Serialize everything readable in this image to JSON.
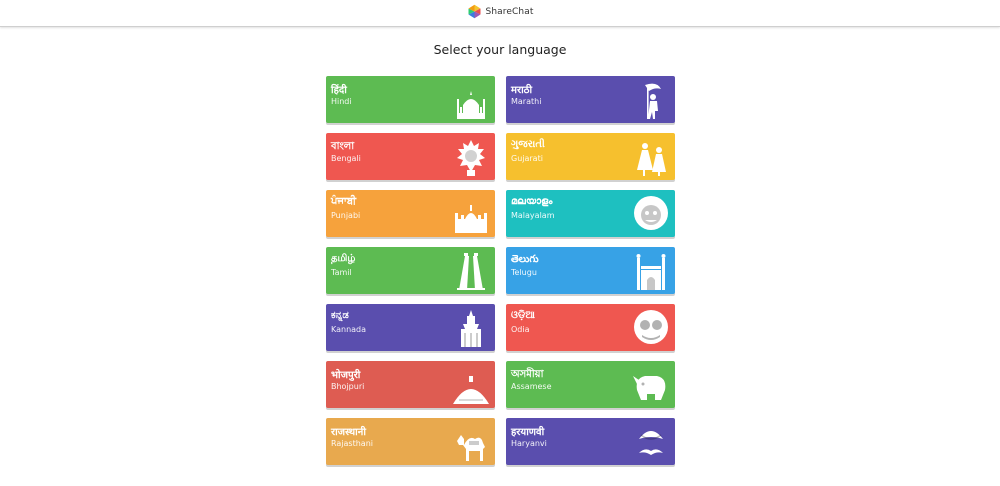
{
  "header": {
    "app_name": "ShareChat",
    "logo_icon": "sharechat-logo-icon"
  },
  "page": {
    "title": "Select your language"
  },
  "languages": [
    {
      "native": "हिंदी",
      "english": "Hindi",
      "color": "#5dbb52",
      "icon": "taj-mahal-icon"
    },
    {
      "native": "मराठी",
      "english": "Marathi",
      "color": "#5a4eae",
      "icon": "flag-bearer-icon"
    },
    {
      "native": "বাংলা",
      "english": "Bengali",
      "color": "#ef5750",
      "icon": "goddess-face-icon"
    },
    {
      "native": "ગુજરાતી",
      "english": "Gujarati",
      "color": "#f6c02e",
      "icon": "garba-dancers-icon"
    },
    {
      "native": "ਪੰਜਾਬੀ",
      "english": "Punjabi",
      "color": "#f6a23c",
      "icon": "golden-temple-icon"
    },
    {
      "native": "മലയാളം",
      "english": "Malayalam",
      "color": "#1ec0c0",
      "icon": "kathakali-face-icon"
    },
    {
      "native": "தமிழ்",
      "english": "Tamil",
      "color": "#5dbb52",
      "icon": "temple-gopuram-icon"
    },
    {
      "native": "తెలుగు",
      "english": "Telugu",
      "color": "#37a2e6",
      "icon": "charminar-icon"
    },
    {
      "native": "ಕನ್ನಡ",
      "english": "Kannada",
      "color": "#5a4eae",
      "icon": "palace-tower-icon"
    },
    {
      "native": "ଓଡ଼ିଆ",
      "english": "Odia",
      "color": "#ef5750",
      "icon": "jagannath-face-icon"
    },
    {
      "native": "भोजपुरी",
      "english": "Bhojpuri",
      "color": "#de5c52",
      "icon": "stupa-icon"
    },
    {
      "native": "অসমীয়া",
      "english": "Assamese",
      "color": "#5dbb52",
      "icon": "rhinoceros-icon"
    },
    {
      "native": "राजस्थानी",
      "english": "Rajasthani",
      "color": "#e8a94e",
      "icon": "camel-icon"
    },
    {
      "native": "हरयाणवी",
      "english": "Haryanvi",
      "color": "#5a4eae",
      "icon": "turban-mustache-icon"
    }
  ]
}
